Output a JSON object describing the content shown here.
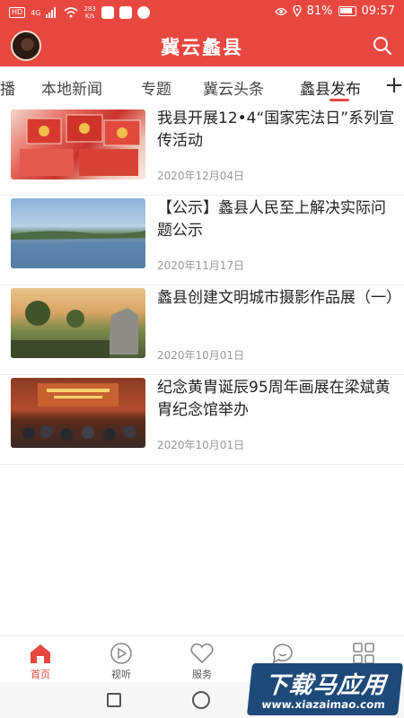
{
  "status_bar": {
    "network_badge": "HD",
    "signal": "4G",
    "speed_value": "283",
    "speed_unit": "K/s",
    "battery": "81%",
    "time": "09:57"
  },
  "header": {
    "title": "冀云蠡县"
  },
  "tabs": [
    {
      "label": "播"
    },
    {
      "label": "本地新闻"
    },
    {
      "label": "专题"
    },
    {
      "label": "冀云头条"
    },
    {
      "label": "蠡县发布",
      "active": true
    }
  ],
  "tab_add_label": "+",
  "news": [
    {
      "title": "我县开展12•4“国家宪法日”系列宣传活动",
      "date": "2020年12月04日"
    },
    {
      "title": "【公示】蠡县人民至上解决实际问题公示",
      "date": "2020年11月17日"
    },
    {
      "title": "蠡县创建文明城市摄影作品展（一）",
      "date": "2020年10月01日"
    },
    {
      "title": "纪念黄胄诞辰95周年画展在梁斌黄胄纪念馆举办",
      "date": "2020年10月01日"
    }
  ],
  "bottom_nav": [
    {
      "label": "首页",
      "icon": "home-icon",
      "active": true
    },
    {
      "label": "视听",
      "icon": "play-icon"
    },
    {
      "label": "服务",
      "icon": "heart-icon"
    },
    {
      "label": "",
      "icon": "chat-icon"
    },
    {
      "label": "",
      "icon": "grid-icon"
    }
  ],
  "watermark": {
    "main": "下载马应用",
    "sub": "www.xiazaimao.com"
  },
  "colors": {
    "brand": "#e8473f",
    "text": "#222222",
    "date": "#999999"
  }
}
